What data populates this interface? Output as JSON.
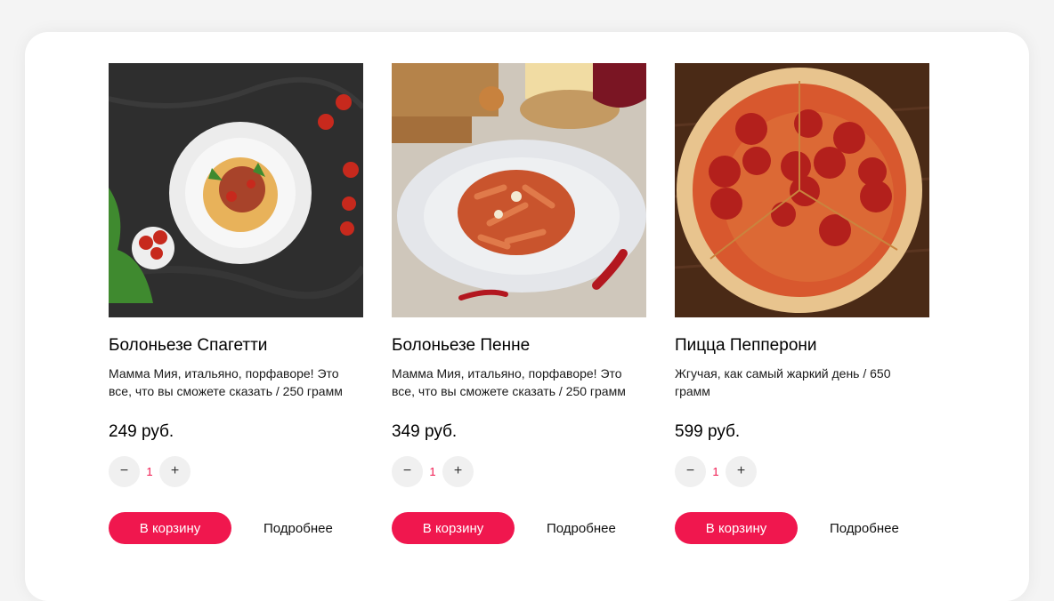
{
  "products": [
    {
      "image": "spaghetti-bolognese-photo",
      "title": "Болоньезе Спагетти",
      "description": "Мамма Мия, итальяно, порфаворе! Это все, что вы сможете сказать / 250 грамм",
      "price": "249 руб.",
      "quantity": "1",
      "minus": "−",
      "plus": "+",
      "cart_label": "В корзину",
      "more_label": "Подробнее"
    },
    {
      "image": "penne-bolognese-photo",
      "title": "Болоньезе Пенне",
      "description": "Мамма Мия, итальяно, порфаворе! Это все, что вы сможете сказать / 250 грамм",
      "price": "349 руб.",
      "quantity": "1",
      "minus": "−",
      "plus": "+",
      "cart_label": "В корзину",
      "more_label": "Подробнее"
    },
    {
      "image": "pepperoni-pizza-photo",
      "title": "Пицца Пепперони",
      "description": "Жгучая, как самый жаркий день / 650 грамм",
      "price": "599 руб.",
      "quantity": "1",
      "minus": "−",
      "plus": "+",
      "cart_label": "В корзину",
      "more_label": "Подробнее"
    }
  ],
  "colors": {
    "accent": "#f0174e",
    "stepper_bg": "#f0f0f0",
    "panel_bg": "#ffffff",
    "page_bg": "#f4f4f4"
  }
}
